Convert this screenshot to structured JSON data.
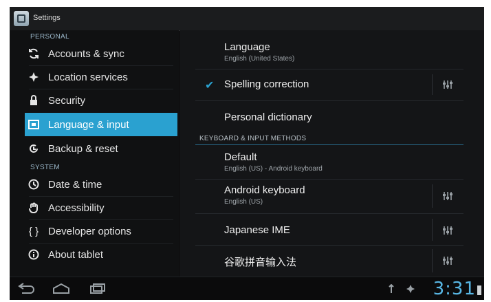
{
  "titlebar": {
    "title": "Settings"
  },
  "left": {
    "sections": {
      "personal": "PERSONAL",
      "system": "SYSTEM"
    },
    "items": [
      {
        "label": "Accounts & sync"
      },
      {
        "label": "Location services"
      },
      {
        "label": "Security"
      },
      {
        "label": "Language & input"
      },
      {
        "label": "Backup & reset"
      },
      {
        "label": "Date & time"
      },
      {
        "label": "Accessibility"
      },
      {
        "label": "Developer options"
      },
      {
        "label": "About tablet"
      }
    ]
  },
  "right": {
    "language": {
      "title": "Language",
      "summary": "English (United States)"
    },
    "spelling": {
      "title": "Spelling correction"
    },
    "dictionary": {
      "title": "Personal dictionary"
    },
    "category": "KEYBOARD & INPUT METHODS",
    "default": {
      "title": "Default",
      "summary": "English (US) - Android keyboard"
    },
    "android_keyboard": {
      "title": "Android keyboard",
      "summary": "English (US)"
    },
    "japanese_ime": {
      "title": "Japanese IME"
    },
    "chinese_ime": {
      "title": "谷歌拼音输入法"
    }
  },
  "statusbar": {
    "clock": "3:31"
  },
  "colors": {
    "accent": "#2aa1d0",
    "clock": "#58b7e5"
  },
  "icons": {
    "nav": [
      "back-icon",
      "home-icon",
      "recent-apps-icon"
    ],
    "status": [
      "usb-icon",
      "location-icon",
      "battery-icon"
    ]
  }
}
